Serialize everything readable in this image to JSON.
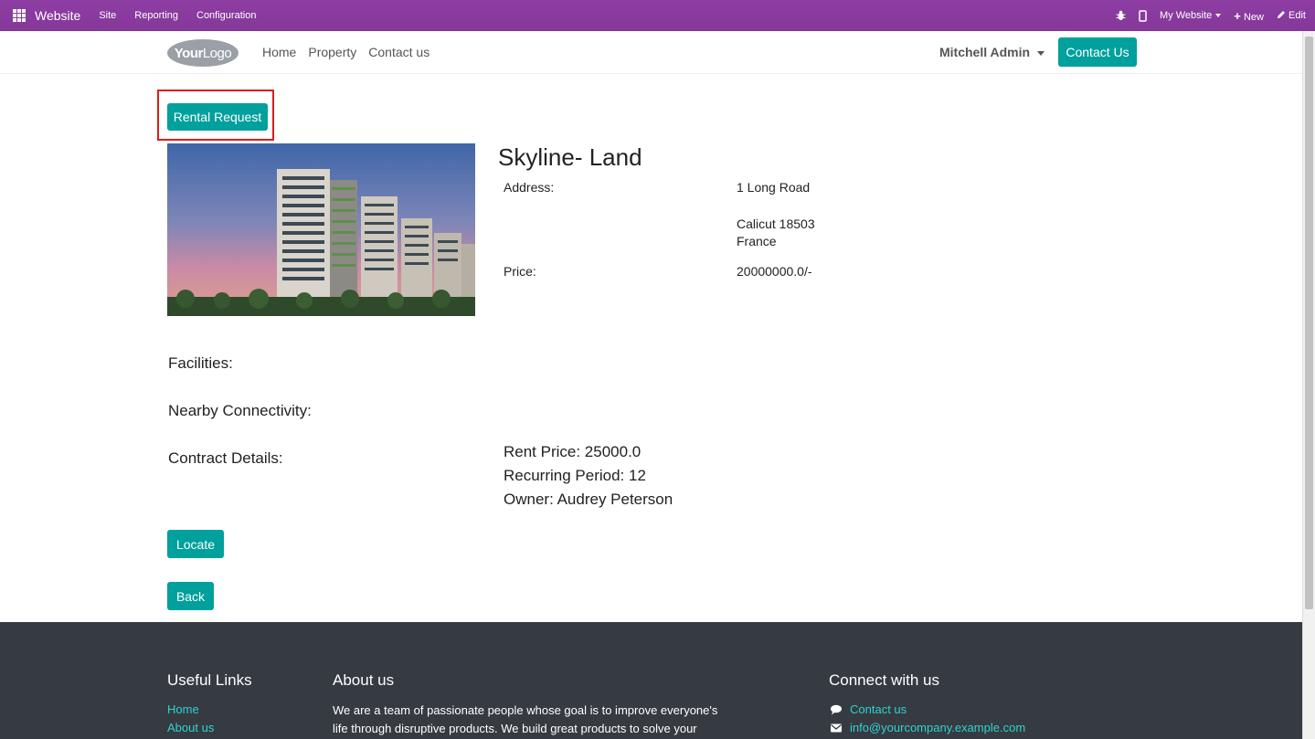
{
  "adminbar": {
    "brand": "Website",
    "menu": [
      "Site",
      "Reporting",
      "Configuration"
    ],
    "my_website": "My Website",
    "new": "New",
    "edit": "Edit"
  },
  "header": {
    "logo_bold": "Your",
    "logo_light": "Logo",
    "nav": [
      "Home",
      "Property",
      "Contact us"
    ],
    "user": "Mitchell Admin",
    "contact_button": "Contact Us"
  },
  "property": {
    "rental_request": "Rental Request",
    "title": "Skyline- Land",
    "address_label": "Address:",
    "address_line1": "1 Long Road",
    "address_line2": "Calicut 18503",
    "address_line3": "France",
    "price_label": "Price:",
    "price_value": "20000000.0/-",
    "facilities_label": "Facilities:",
    "nearby_label": "Nearby Connectivity:",
    "contract_label": "Contract Details:",
    "rent_price": "Rent Price: 25000.0",
    "recurring_period": "Recurring Period: 12",
    "owner": "Owner: Audrey Peterson",
    "locate": "Locate",
    "back": "Back"
  },
  "footer": {
    "useful_links_title": "Useful Links",
    "links": [
      "Home",
      "About us"
    ],
    "about_title": "About us",
    "about_text": "We are a team of passionate people whose goal is to improve everyone's life through disruptive products. We build great products to solve your",
    "connect_title": "Connect with us",
    "contact_link": "Contact us",
    "email_link": "info@yourcompany.example.com"
  },
  "colors": {
    "admin_bar": "#8e3ea3",
    "accent": "#00a09d",
    "footer_bg": "#363b41",
    "footer_link": "#2fd2d2",
    "highlight": "#e01b1b"
  }
}
